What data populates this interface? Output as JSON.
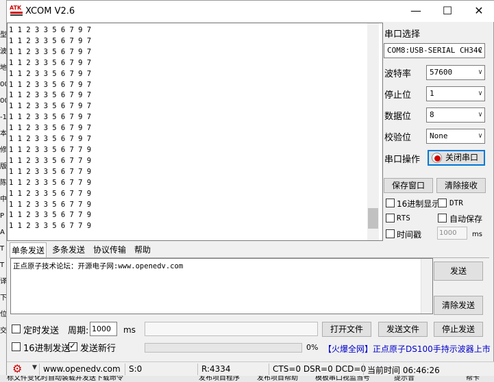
{
  "window": {
    "title": "XCOM V2.6",
    "logo_text": "ATK"
  },
  "receive_lines": [
    "1 1 2 3 3 5 6 7 9 7",
    "1 1 2 3 3 5 6 7 9 7",
    "1 1 2 3 3 5 6 7 9 7",
    "1 1 2 3 3 5 6 7 9 7",
    "1 1 2 3 3 5 6 7 9 7",
    "1 1 2 3 3 5 6 7 9 7",
    "1 1 2 3 3 5 6 7 9 7",
    "1 1 2 3 3 5 6 7 9 7",
    "1 1 2 3 3 5 6 7 9 7",
    "1 1 2 3 3 5 6 7 9 7",
    "1 1 2 3 3 5 6 7 9 7",
    "1 1 2 3 3 5 6 7 7 9",
    "1 1 2 3 3 5 6 7 7 9",
    "1 1 2 3 3 5 6 7 7 9",
    "1 1 2 3 3 5 6 7 7 9",
    "1 1 2 3 3 5 6 7 7 9",
    "1 1 2 3 3 5 6 7 7 9",
    "1 1 2 3 3 5 6 7 7 9",
    "1 1 2 3 3 5 6 7 7 9"
  ],
  "settings": {
    "port_select_label": "串口选择",
    "port_value": "COM8:USB-SERIAL CH34C",
    "baud_label": "波特率",
    "baud_value": "57600",
    "stopbits_label": "停止位",
    "stopbits_value": "1",
    "databits_label": "数据位",
    "databits_value": "8",
    "parity_label": "校验位",
    "parity_value": "None",
    "port_op_label": "串口操作",
    "close_port_button": "关闭串口",
    "save_window_button": "保存窗口",
    "clear_receive_button": "清除接收",
    "hex_display_label": "16进制显示",
    "dtr_label": "DTR",
    "rts_label": "RTS",
    "auto_save_label": "自动保存",
    "timestamp_label": "时间戳",
    "timestamp_value": "1000",
    "timestamp_unit": "ms"
  },
  "tabs": [
    "单条发送",
    "多条发送",
    "协议传输",
    "帮助"
  ],
  "send": {
    "text": "正点原子技术论坛：开源电子网:www.openedv.com",
    "send_button": "发送",
    "clear_send_button": "清除发送"
  },
  "bottom": {
    "timed_send_label": "定时发送",
    "period_label": "周期:",
    "period_value": "1000",
    "period_unit": "ms",
    "open_file_button": "打开文件",
    "send_file_button": "发送文件",
    "stop_send_button": "停止发送",
    "hex_send_label": "16进制发送",
    "send_newline_label": "发送新行",
    "progress_percent": "0%",
    "progress_value": 0,
    "ad_text": "【火爆全网】正点原子DS100手持示波器上市"
  },
  "status": {
    "url": "www.openedv.com",
    "sent": "S:0",
    "received": "R:4334",
    "lines": "CTS=0 DSR=0 DCD=0",
    "time": "当前时间 06:46:26"
  },
  "background": {
    "left_chars": [
      "型",
      "波",
      "地",
      "00",
      "00",
      "-1",
      "本",
      "修",
      "版",
      "陈",
      "中",
      "P",
      "A",
      "T",
      "T",
      "译",
      "下",
      "位",
      "交"
    ],
    "bottom_texts": [
      "标文件变化时自动装载并发送下载命令",
      "发布项目程序",
      "发布项目帮助",
      "模板串口视监当号",
      "提示音",
      "帮卡"
    ],
    "right_fragments": [
      "首",
      "\\"
    ]
  },
  "colors": {
    "accent_red": "#d00000",
    "ad_blue": "#0000cc",
    "link_blue": "#0066cc"
  }
}
